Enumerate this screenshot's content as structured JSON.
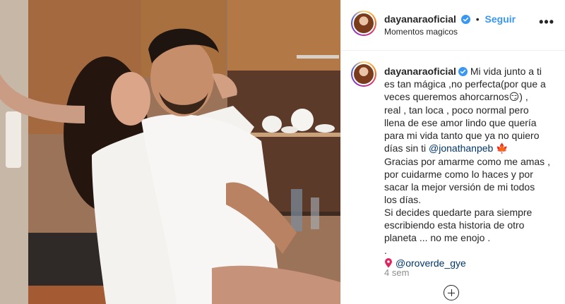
{
  "post": {
    "username": "dayanaraoficial",
    "follow_label": "Seguir",
    "separator": "•",
    "location": "Momentos magicos",
    "more_label": "•••"
  },
  "caption": {
    "username": "dayanaraoficial",
    "line1": "Mi vida junto a ti",
    "line2": "es tan mágica ,no perfecta(por que a",
    "line3a": "veces queremos ahorcarnos",
    "line3_emoji": "😏",
    "line3b": ") ,",
    "line4": "real , tan loca , poco normal pero",
    "line5": "llena de ese amor lindo que quería",
    "line6": "para mi vida tanto que ya no quiero",
    "line7a": "días sin ti ",
    "mention": "@jonathanpeb",
    "line7_emoji": "🍁",
    "line8": "Gracias por amarme como me amas ,",
    "line9": "por cuidarme como lo haces y por",
    "line10": "sacar la mejor versión de mi todos",
    "line11": "los días.",
    "line12": "Si decides quedarte para siempre",
    "line13": "escribiendo esta historia de otro",
    "line14": "planeta ... no me enojo .",
    "line15": ".",
    "location_tag": "@oroverde_gye"
  },
  "timestamp": "4 sem",
  "icons": {
    "verified": "verified-badge-icon",
    "more": "more-options-icon",
    "pin": "location-pin-icon",
    "add": "add-circle-icon"
  },
  "colors": {
    "follow": "#3897f0",
    "mention": "#00376b",
    "verified": "#3897f0",
    "timestamp": "#8e8e8e"
  }
}
